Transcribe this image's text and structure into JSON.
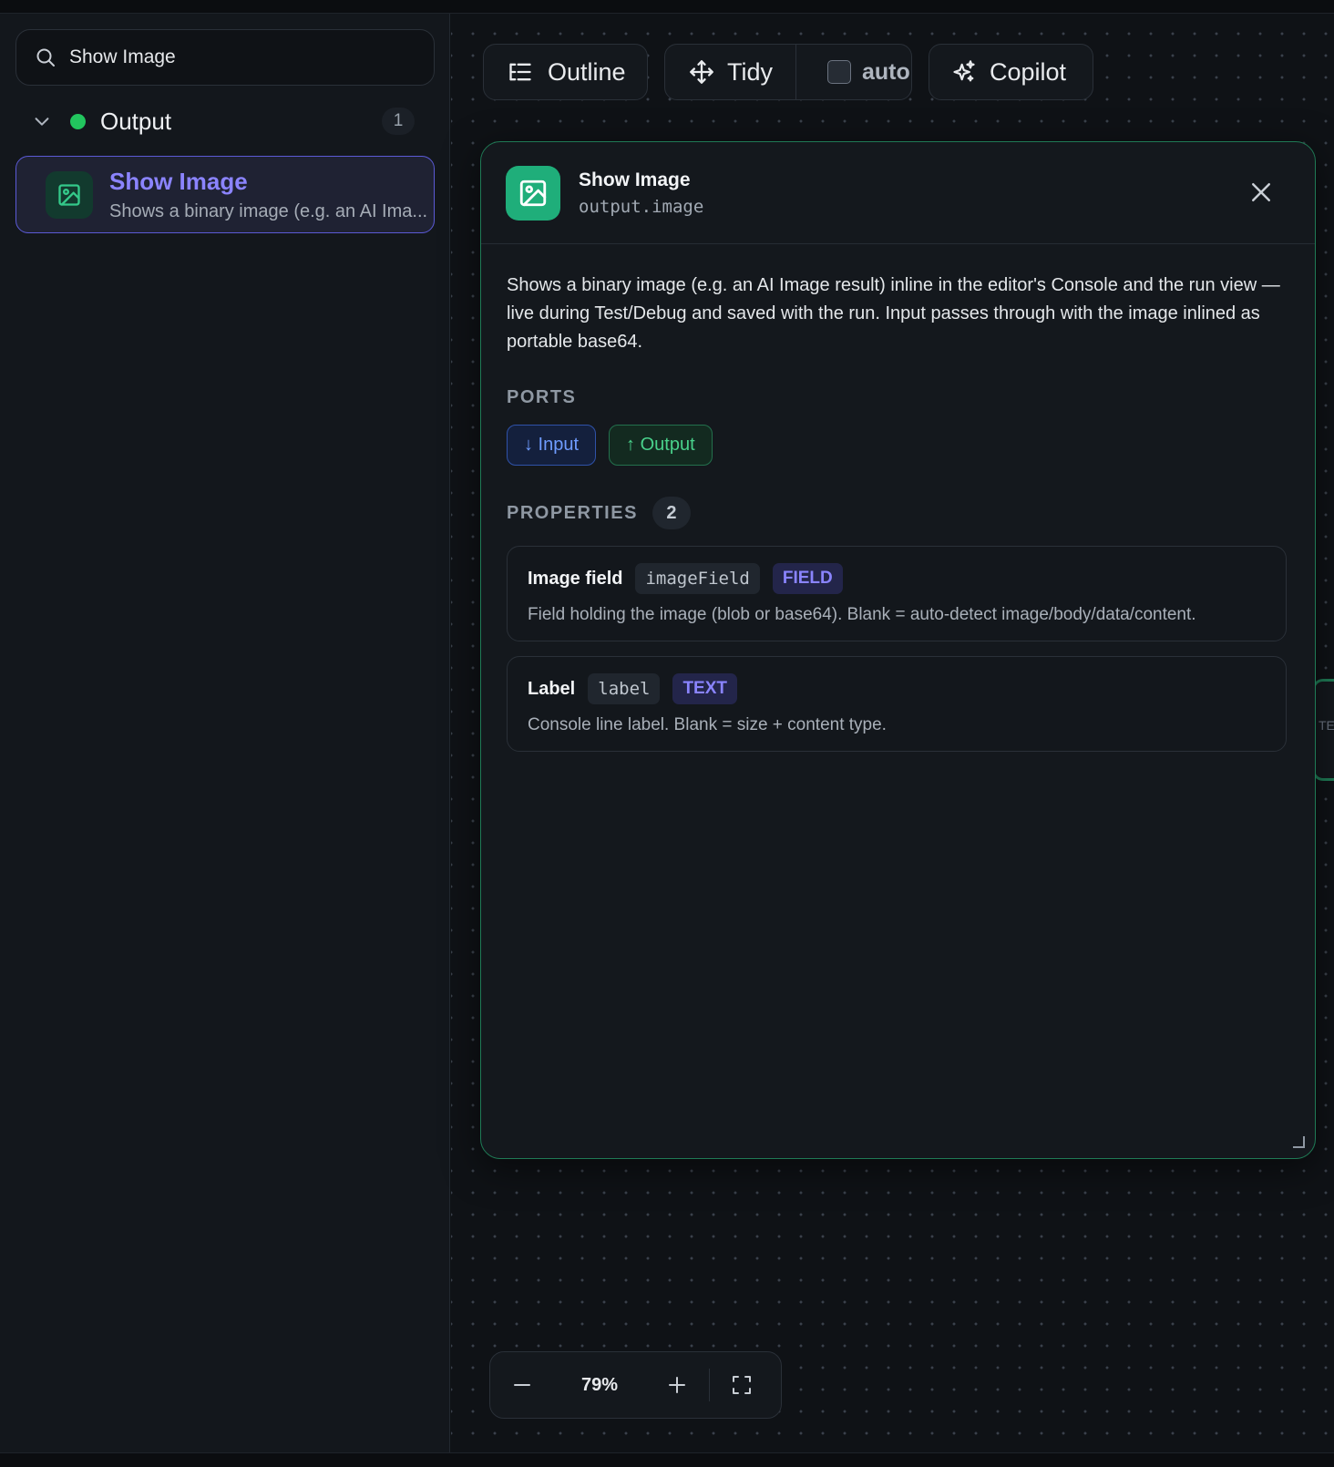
{
  "sidebar": {
    "search": {
      "value": "Show Image",
      "icon": "search-icon"
    },
    "group": {
      "label": "Output",
      "count": "1",
      "status_color": "#22c55e"
    },
    "items": [
      {
        "title": "Show Image",
        "description": "Shows a binary image (e.g. an AI Ima...",
        "icon": "image-icon"
      }
    ]
  },
  "toolbar": {
    "outline_label": "Outline",
    "tidy_label": "Tidy",
    "auto_label": "auto",
    "auto_checked": false,
    "copilot_label": "Copilot"
  },
  "panel": {
    "title": "Show Image",
    "id": "output.image",
    "description": "Shows a binary image (e.g. an AI Image result) inline in the editor's Console and the run view — live during Test/Debug and saved with the run. Input passes through with the image inlined as portable base64.",
    "ports_heading": "PORTS",
    "ports": [
      {
        "label": "↓ Input",
        "kind": "input"
      },
      {
        "label": "↑ Output",
        "kind": "output"
      }
    ],
    "properties_heading": "PROPERTIES",
    "properties_count": "2",
    "properties": [
      {
        "name": "Image field",
        "key": "imageField",
        "type": "FIELD",
        "help": "Field holding the image (blob or base64). Blank = auto-detect image/body/data/content."
      },
      {
        "name": "Label",
        "key": "label",
        "type": "TEXT",
        "help": "Console line label. Blank = size + content type."
      }
    ]
  },
  "edge_node": {
    "text": "TE"
  },
  "zoom": {
    "level": "79%"
  },
  "colors": {
    "accent": "#8b84ff",
    "node_green": "#1fae7a",
    "panel_border": "#1f7a55"
  }
}
